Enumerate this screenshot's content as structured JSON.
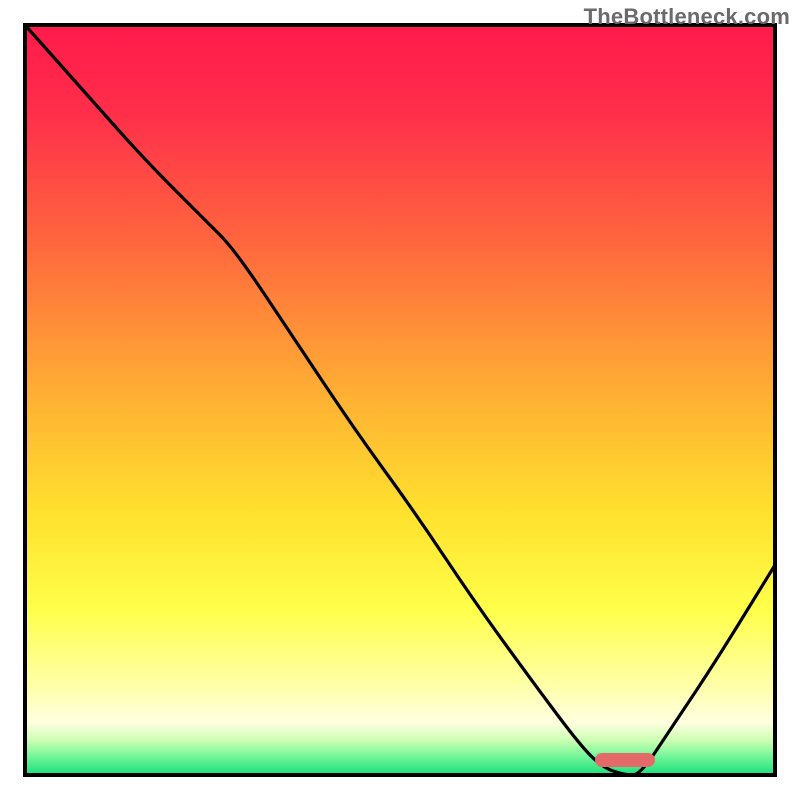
{
  "watermark": "TheBottleneck.com",
  "chart_data": {
    "type": "line",
    "title": "",
    "xlabel": "",
    "ylabel": "",
    "xlim": [
      0,
      100
    ],
    "ylim": [
      0,
      100
    ],
    "gradient_stops": [
      {
        "offset": 0.0,
        "color": "#ff1a4b"
      },
      {
        "offset": 0.12,
        "color": "#ff2f4a"
      },
      {
        "offset": 0.3,
        "color": "#ff6a3d"
      },
      {
        "offset": 0.5,
        "color": "#ffb233"
      },
      {
        "offset": 0.65,
        "color": "#ffe12e"
      },
      {
        "offset": 0.78,
        "color": "#ffff4a"
      },
      {
        "offset": 0.88,
        "color": "#ffffa8"
      },
      {
        "offset": 0.93,
        "color": "#ffffe0"
      },
      {
        "offset": 0.955,
        "color": "#c8ffb0"
      },
      {
        "offset": 0.975,
        "color": "#74f59a"
      },
      {
        "offset": 1.0,
        "color": "#18e07a"
      }
    ],
    "series": [
      {
        "name": "bottleneck-curve",
        "x": [
          0,
          8,
          16,
          24,
          28,
          36,
          44,
          52,
          60,
          68,
          74,
          77,
          80,
          82,
          86,
          92,
          100
        ],
        "y": [
          100,
          91,
          82,
          74,
          70,
          58,
          46,
          35,
          23,
          12,
          4,
          1,
          0,
          0,
          6,
          15,
          28
        ]
      }
    ],
    "marker": {
      "name": "optimal-marker",
      "x_center": 80,
      "width": 8,
      "color": "#e46a6a"
    }
  }
}
